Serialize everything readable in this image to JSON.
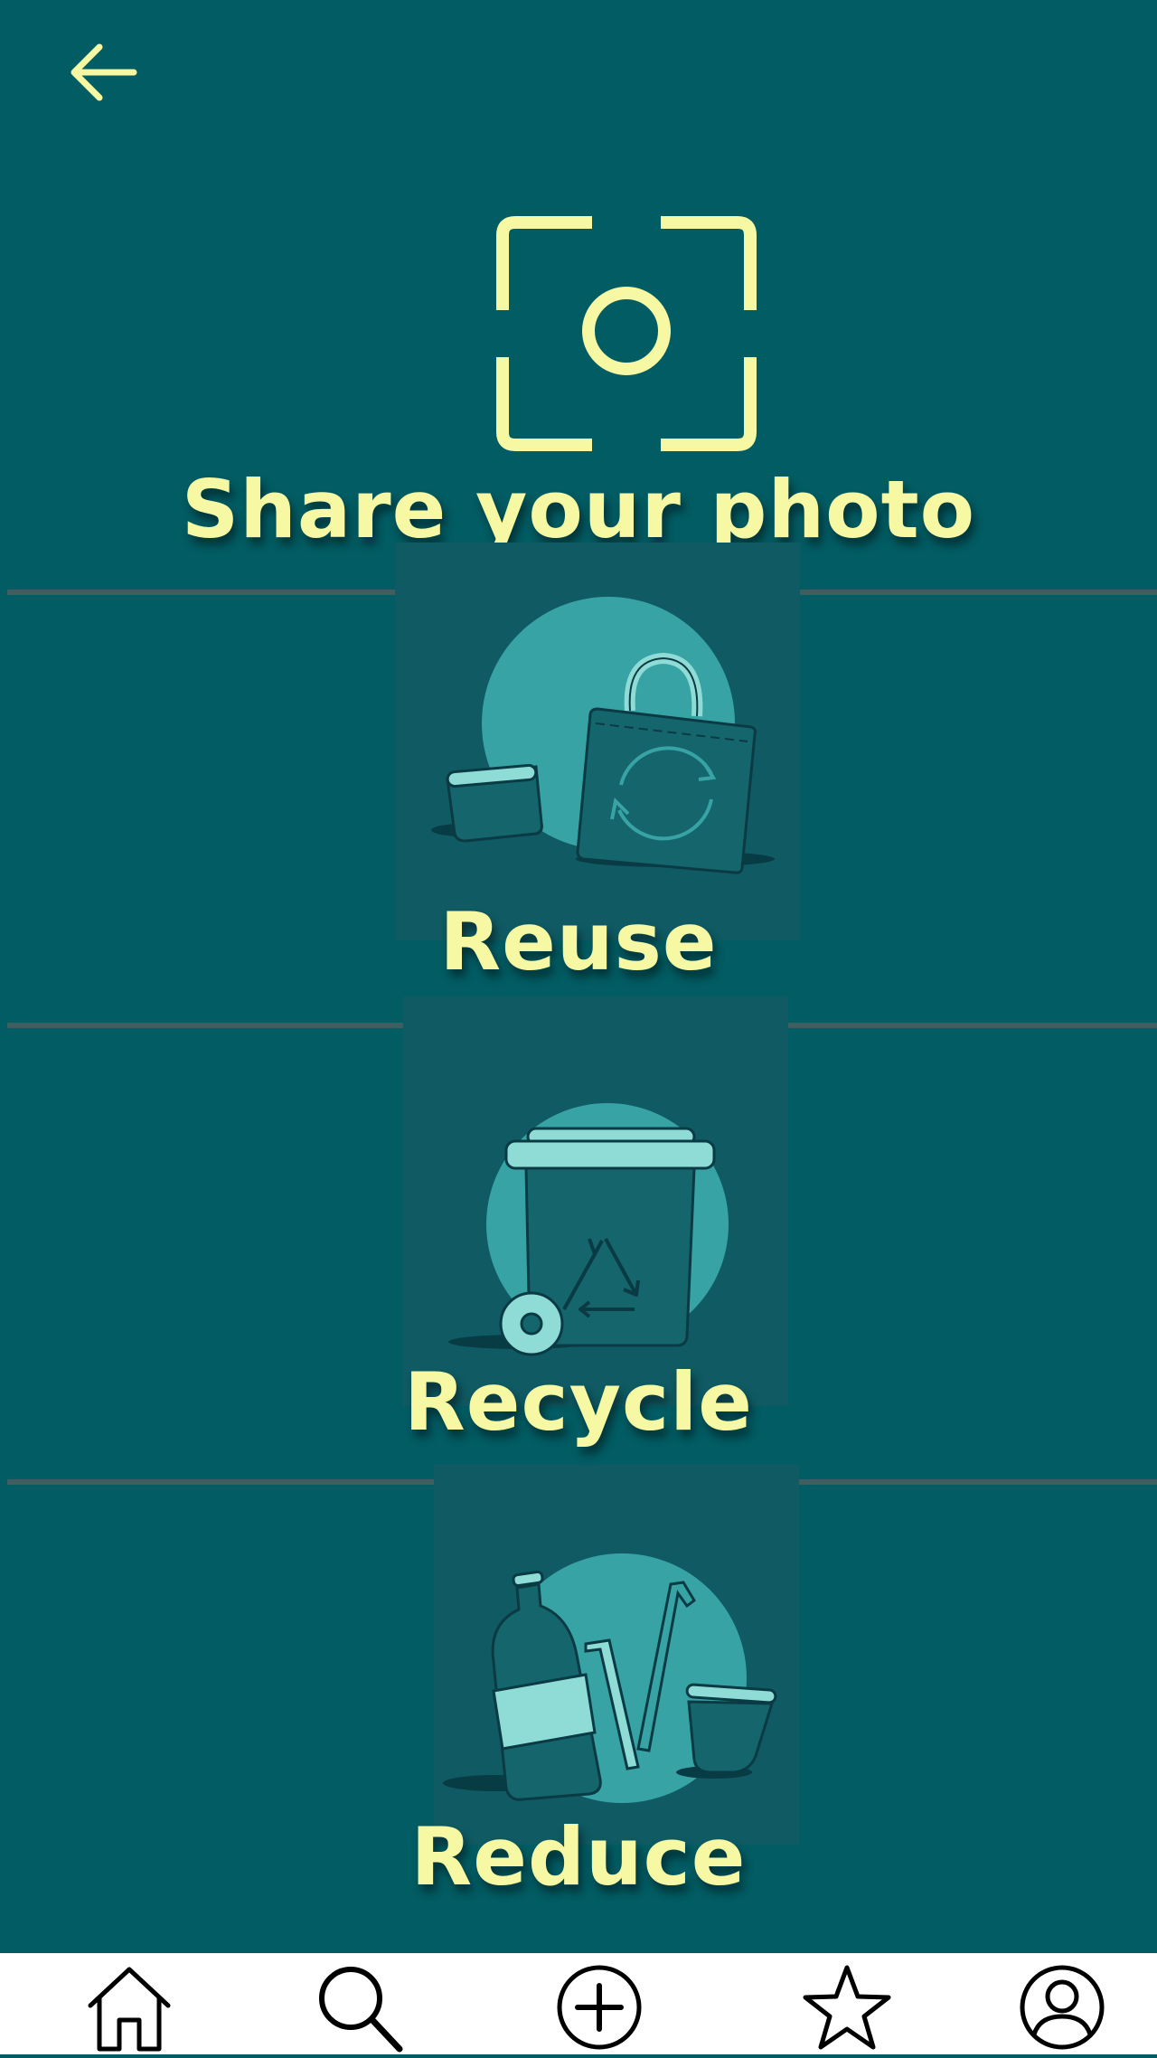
{
  "header": {
    "back_icon": "arrow-left-icon"
  },
  "share": {
    "label": "Share your photo",
    "icon": "camera-scan-icon"
  },
  "categories": [
    {
      "label": "Reuse",
      "icon": "reuse-illustration"
    },
    {
      "label": "Recycle",
      "icon": "recycle-bin-illustration"
    },
    {
      "label": "Reduce",
      "icon": "reduce-illustration"
    }
  ],
  "bottom_nav": [
    {
      "icon": "home-icon"
    },
    {
      "icon": "search-icon"
    },
    {
      "icon": "add-icon"
    },
    {
      "icon": "star-icon"
    },
    {
      "icon": "profile-icon"
    }
  ],
  "colors": {
    "background": "#025c63",
    "accent": "#f6f8a4",
    "illustration_teal": "#38a3a5",
    "illustration_light": "#8fdcd6",
    "divider": "#3f5e5f",
    "nav_background": "#ffffff"
  }
}
